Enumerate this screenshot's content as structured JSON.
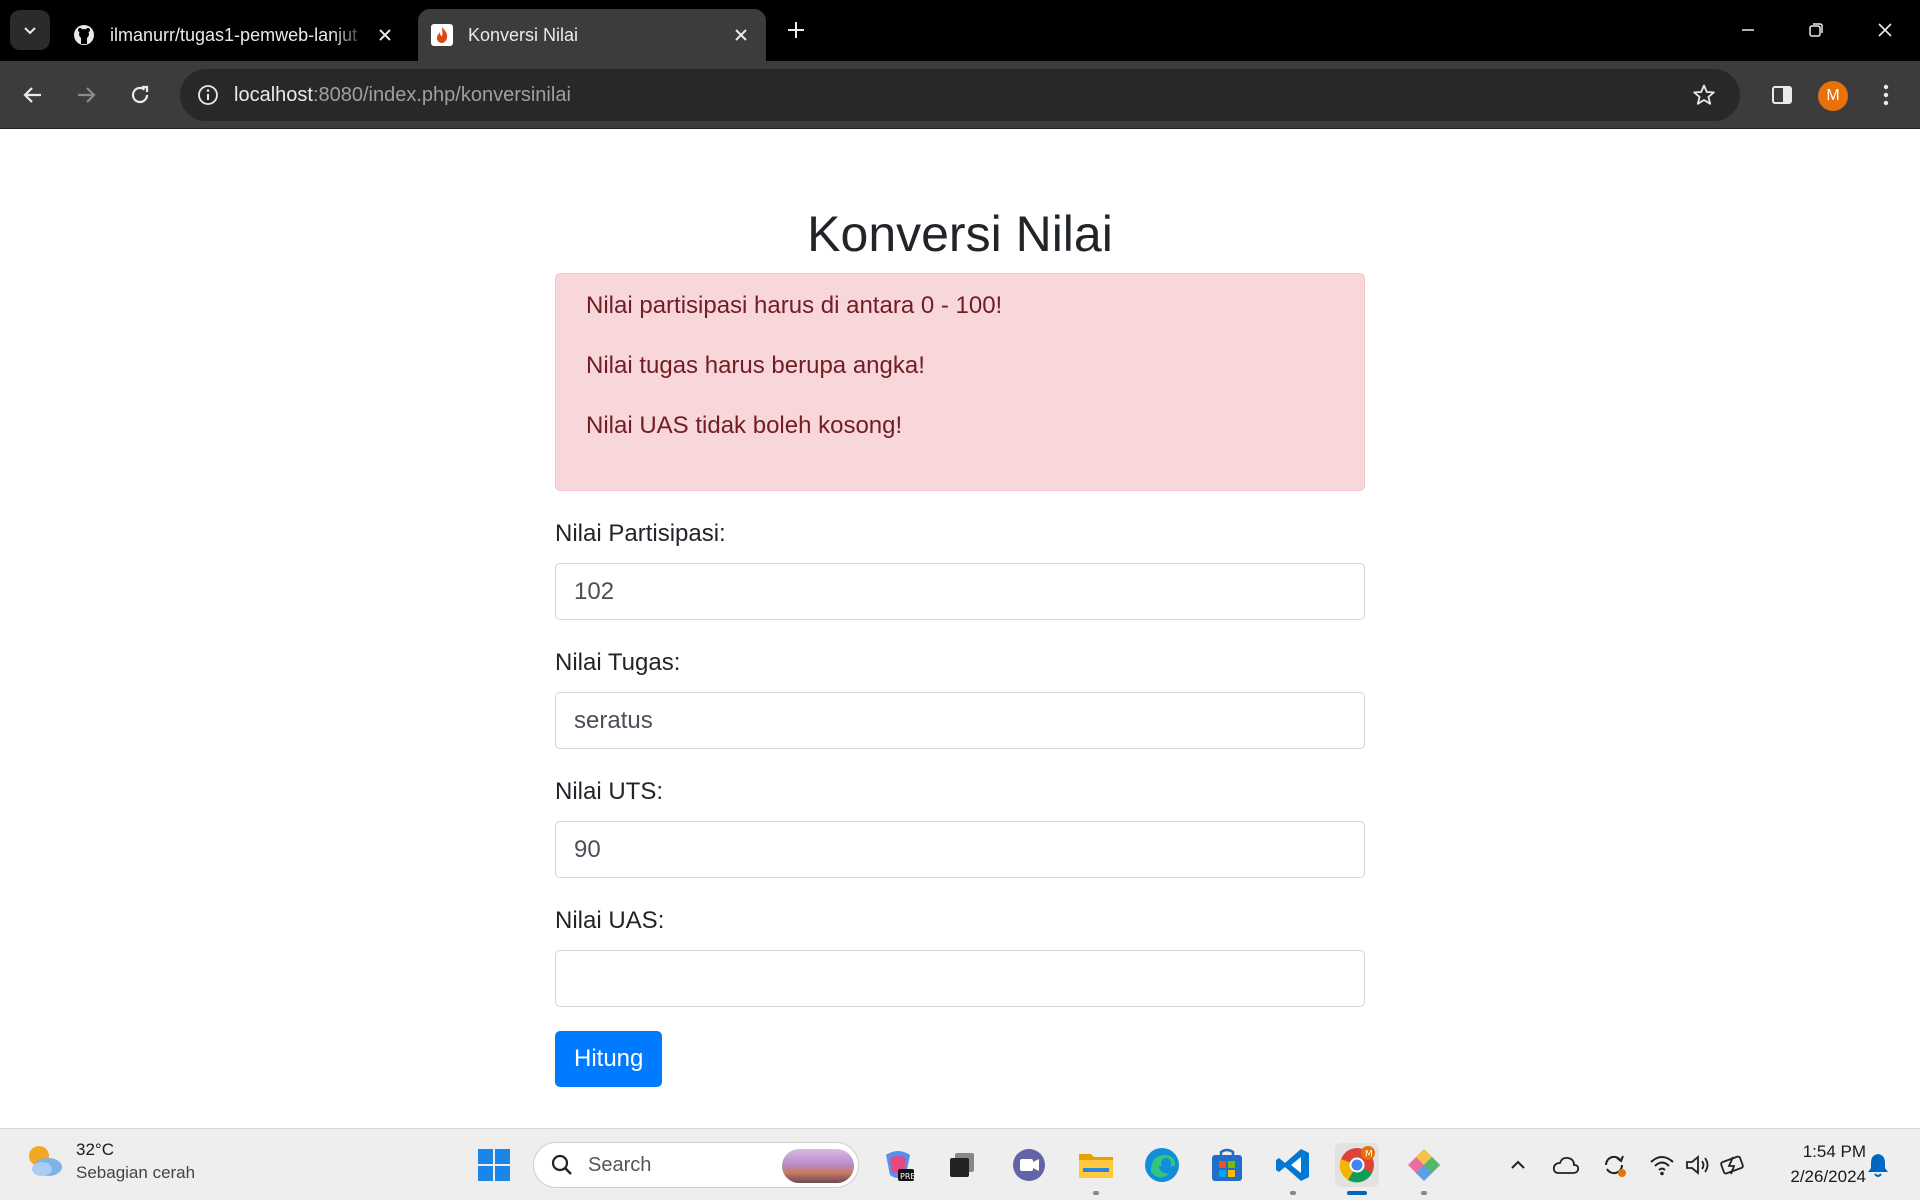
{
  "browser": {
    "tabs": [
      {
        "title": "ilmanurr/tugas1-pemweb-lanjut",
        "icon": "github-icon",
        "active": false
      },
      {
        "title": "Konversi Nilai",
        "icon": "codeigniter-icon",
        "active": true
      }
    ],
    "url_host": "localhost",
    "url_rest": ":8080/index.php/konversinilai",
    "profile_initial": "M"
  },
  "page": {
    "title": "Konversi Nilai",
    "errors": [
      "Nilai partisipasi harus di antara 0 - 100!",
      "Nilai tugas harus berupa angka!",
      "Nilai UAS tidak boleh kosong!"
    ],
    "form": {
      "partisipasi": {
        "label": "Nilai Partisipasi:",
        "value": "102"
      },
      "tugas": {
        "label": "Nilai Tugas:",
        "value": "seratus"
      },
      "uts": {
        "label": "Nilai UTS:",
        "value": "90"
      },
      "uas": {
        "label": "Nilai UAS:",
        "value": ""
      },
      "submit_label": "Hitung"
    }
  },
  "taskbar": {
    "weather": {
      "temp": "32°C",
      "desc": "Sebagian cerah"
    },
    "search_placeholder": "Search",
    "pinned": [
      "windows-start",
      "copilot",
      "task-view",
      "teams",
      "file-explorer",
      "edge",
      "store",
      "vscode",
      "chrome",
      "git-gui"
    ],
    "clock": {
      "time": "1:54 PM",
      "date": "2/26/2024"
    }
  },
  "colors": {
    "alert_bg": "#f8d7da",
    "alert_text": "#721c24",
    "primary": "#007bff",
    "chrome_dark": "#3c3c3c"
  }
}
